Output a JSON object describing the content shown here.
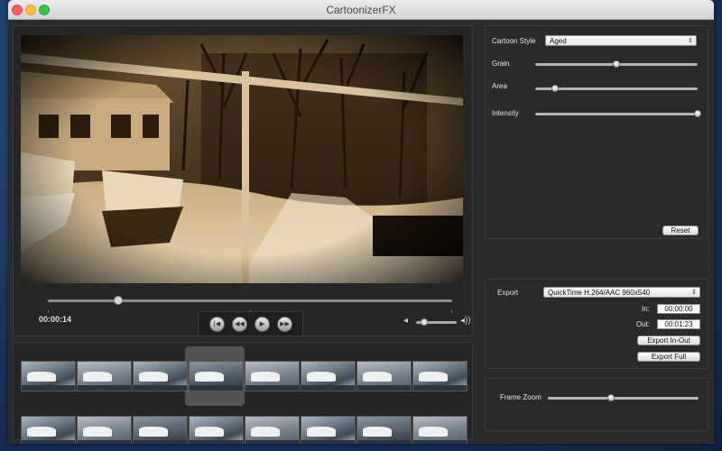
{
  "window": {
    "title": "CartoonizerFX"
  },
  "player": {
    "timecode": "00:00:14",
    "scrub_position": 0.175,
    "volume": 0.2,
    "controls": [
      "skip-to-start",
      "rewind",
      "play",
      "fast-forward"
    ]
  },
  "settings": {
    "cartoon_style_label": "Cartoon Style",
    "cartoon_style_value": "Aged",
    "grain_label": "Grain",
    "grain_value": 0.5,
    "area_label": "Area",
    "area_value": 0.12,
    "intensity_label": "Intensity",
    "intensity_value": 1.0,
    "reset_label": "Reset"
  },
  "export": {
    "label": "Export",
    "format_value": "QuickTime H.264/AAC 960x540",
    "in_label": "In:",
    "in_value": "00:00:00",
    "out_label": "Out:",
    "out_value": "00:01:23",
    "export_in_out_label": "Export In-Out",
    "export_full_label": "Export Full"
  },
  "frame_zoom": {
    "label": "Frame Zoom",
    "value": 0.42
  }
}
